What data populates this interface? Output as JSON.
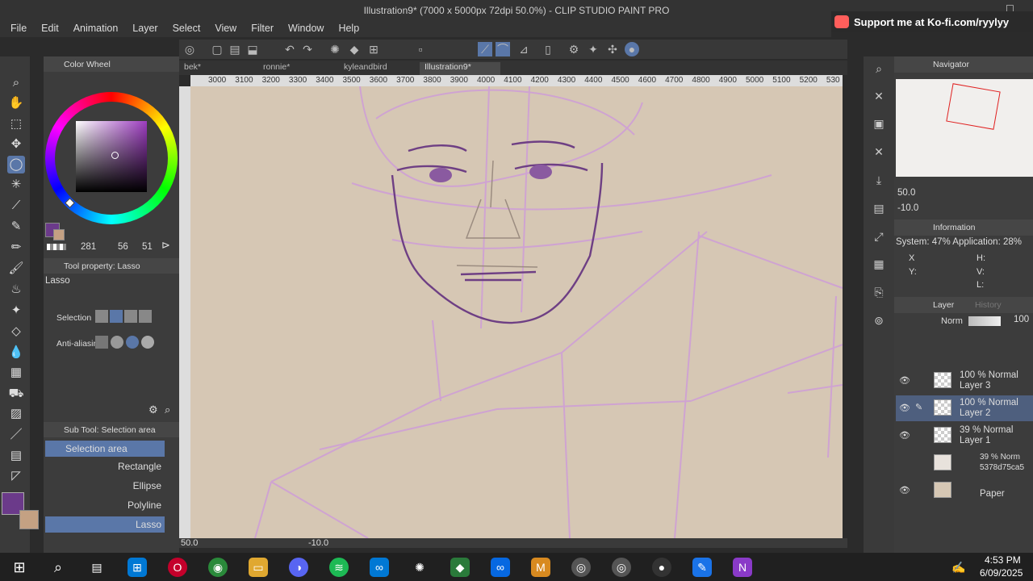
{
  "window": {
    "title": "Illustration9* (7000 x 5000px 72dpi 50.0%)  - CLIP STUDIO PAINT PRO",
    "kofi": "Support me at Ko-fi.com/ryylyy"
  },
  "menu": [
    "File",
    "Edit",
    "Animation",
    "Layer",
    "Select",
    "View",
    "Filter",
    "Window",
    "Help"
  ],
  "color_wheel": {
    "title": "Color Wheel",
    "h": "281",
    "s": "56",
    "v": "51",
    "main_color": "#6b3a8a",
    "sub_color": "#c4a183"
  },
  "tool_property": {
    "title": "Tool property: Lasso",
    "tool_name": "Lasso",
    "selection_label": "Selection",
    "antialias_label": "Anti-aliasin"
  },
  "sub_tool": {
    "title": "Sub Tool: Selection area",
    "items": [
      "Selection area",
      "Rectangle",
      "Ellipse",
      "Polyline",
      "Lasso"
    ]
  },
  "tabs": [
    "bek*",
    "ronnie*",
    "kyleandbird",
    "Illustration9*"
  ],
  "ruler_ticks": [
    "3000",
    "3100",
    "3200",
    "3300",
    "3400",
    "3500",
    "3600",
    "3700",
    "3800",
    "3900",
    "4000",
    "4100",
    "4200",
    "4300",
    "4400",
    "4500",
    "4600",
    "4700",
    "4800",
    "4900",
    "5000",
    "5100",
    "5200",
    "530"
  ],
  "status": {
    "zoom": "50.0",
    "angle": "-10.0"
  },
  "navigator": {
    "title": "Navigator",
    "zoom": "50.0",
    "angle": "-10.0"
  },
  "information": {
    "title": "Information",
    "system": "System: 47% Application: 28%",
    "x": "X",
    "y": "Y:",
    "h": "H:",
    "v": "V:",
    "l": "L:"
  },
  "layer_panel": {
    "title": "Layer",
    "history": "History",
    "blend": "Norm",
    "opacity": "100",
    "layers": [
      {
        "line1": "100 % Normal",
        "line2": "Layer 3"
      },
      {
        "line1": "100 % Normal",
        "line2": "Layer 2"
      },
      {
        "line1": "39 % Normal",
        "line2": "Layer 1"
      },
      {
        "line1": "39 % Norm",
        "line2": "5378d75ca5"
      },
      {
        "line1": "",
        "line2": "Paper"
      }
    ]
  },
  "clock": {
    "time": "4:53 PM",
    "date": "6/09/2025"
  }
}
